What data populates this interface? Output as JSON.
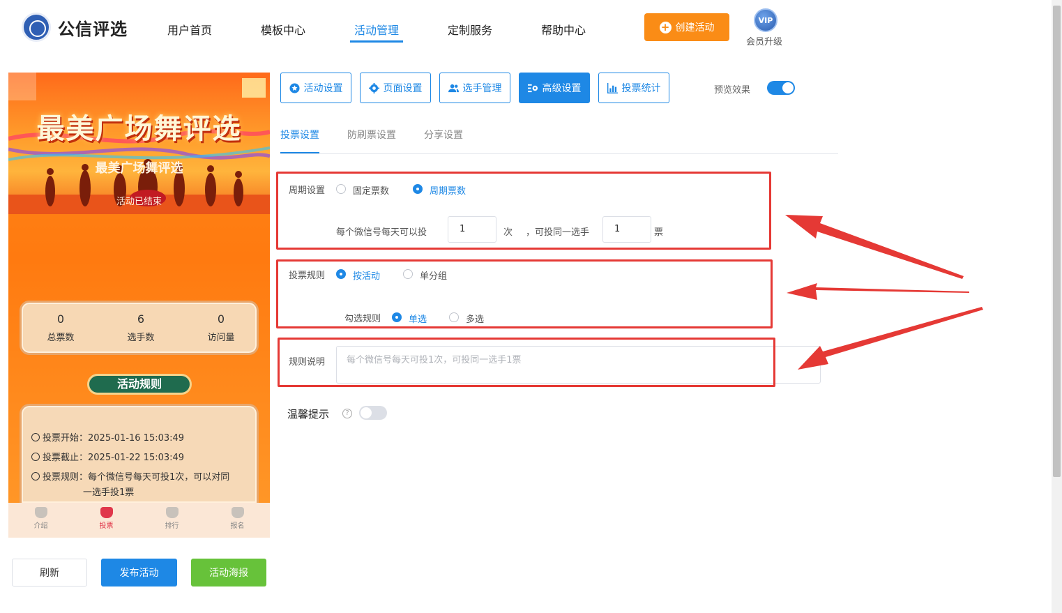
{
  "header": {
    "brand": "公信评选",
    "nav": [
      "用户首页",
      "模板中心",
      "活动管理",
      "定制服务",
      "帮助中心"
    ],
    "create_button": "创建活动",
    "vip_badge": "VIP",
    "vip_label": "会员升级"
  },
  "preview": {
    "banner_title": "最美广场舞评选",
    "activity_title": "最美广场舞评选",
    "status": "活动已结束",
    "stats": [
      {
        "value": "0",
        "label": "总票数"
      },
      {
        "value": "6",
        "label": "选手数"
      },
      {
        "value": "0",
        "label": "访问量"
      }
    ],
    "rules_badge": "活动规则",
    "rules": {
      "start": "投票开始：2025-01-16 15:03:49",
      "end": "投票截止：2025-01-22 15:03:49",
      "rule_line1": "投票规则：每个微信号每天可投1次，可以对同",
      "rule_line2": "一选手投1票"
    },
    "tabbar": [
      "介绍",
      "投票",
      "排行",
      "报名"
    ]
  },
  "footer_buttons": {
    "refresh": "刷新",
    "publish": "发布活动",
    "poster": "活动海报"
  },
  "tools": {
    "items": [
      "活动设置",
      "页面设置",
      "选手管理",
      "高级设置",
      "投票统计"
    ],
    "preview_label": "预览效果"
  },
  "subtabs": [
    "投票设置",
    "防刷票设置",
    "分享设置"
  ],
  "form": {
    "cycle_label": "周期设置",
    "cycle_options": [
      "固定票数",
      "周期票数"
    ],
    "per_day_label": "每个微信号每天可以投",
    "times_value": "1",
    "times_unit": "次",
    "same_player_label": "，可投同一选手",
    "votes_value": "1",
    "votes_unit": "票",
    "vote_rule_label": "投票规则",
    "vote_rule_options": [
      "按活动",
      "单分组"
    ],
    "check_rule_label": "勾选规则",
    "check_rule_options": [
      "单选",
      "多选"
    ],
    "desc_label": "规则说明",
    "desc_placeholder": "每个微信号每天可投1次，可投同一选手1票",
    "tip_label": "温馨提示",
    "help_glyph": "?"
  },
  "colors": {
    "primary": "#1e88e5",
    "orange": "#fa8c16",
    "green": "#67c23a",
    "annotation_red": "#e53935"
  }
}
